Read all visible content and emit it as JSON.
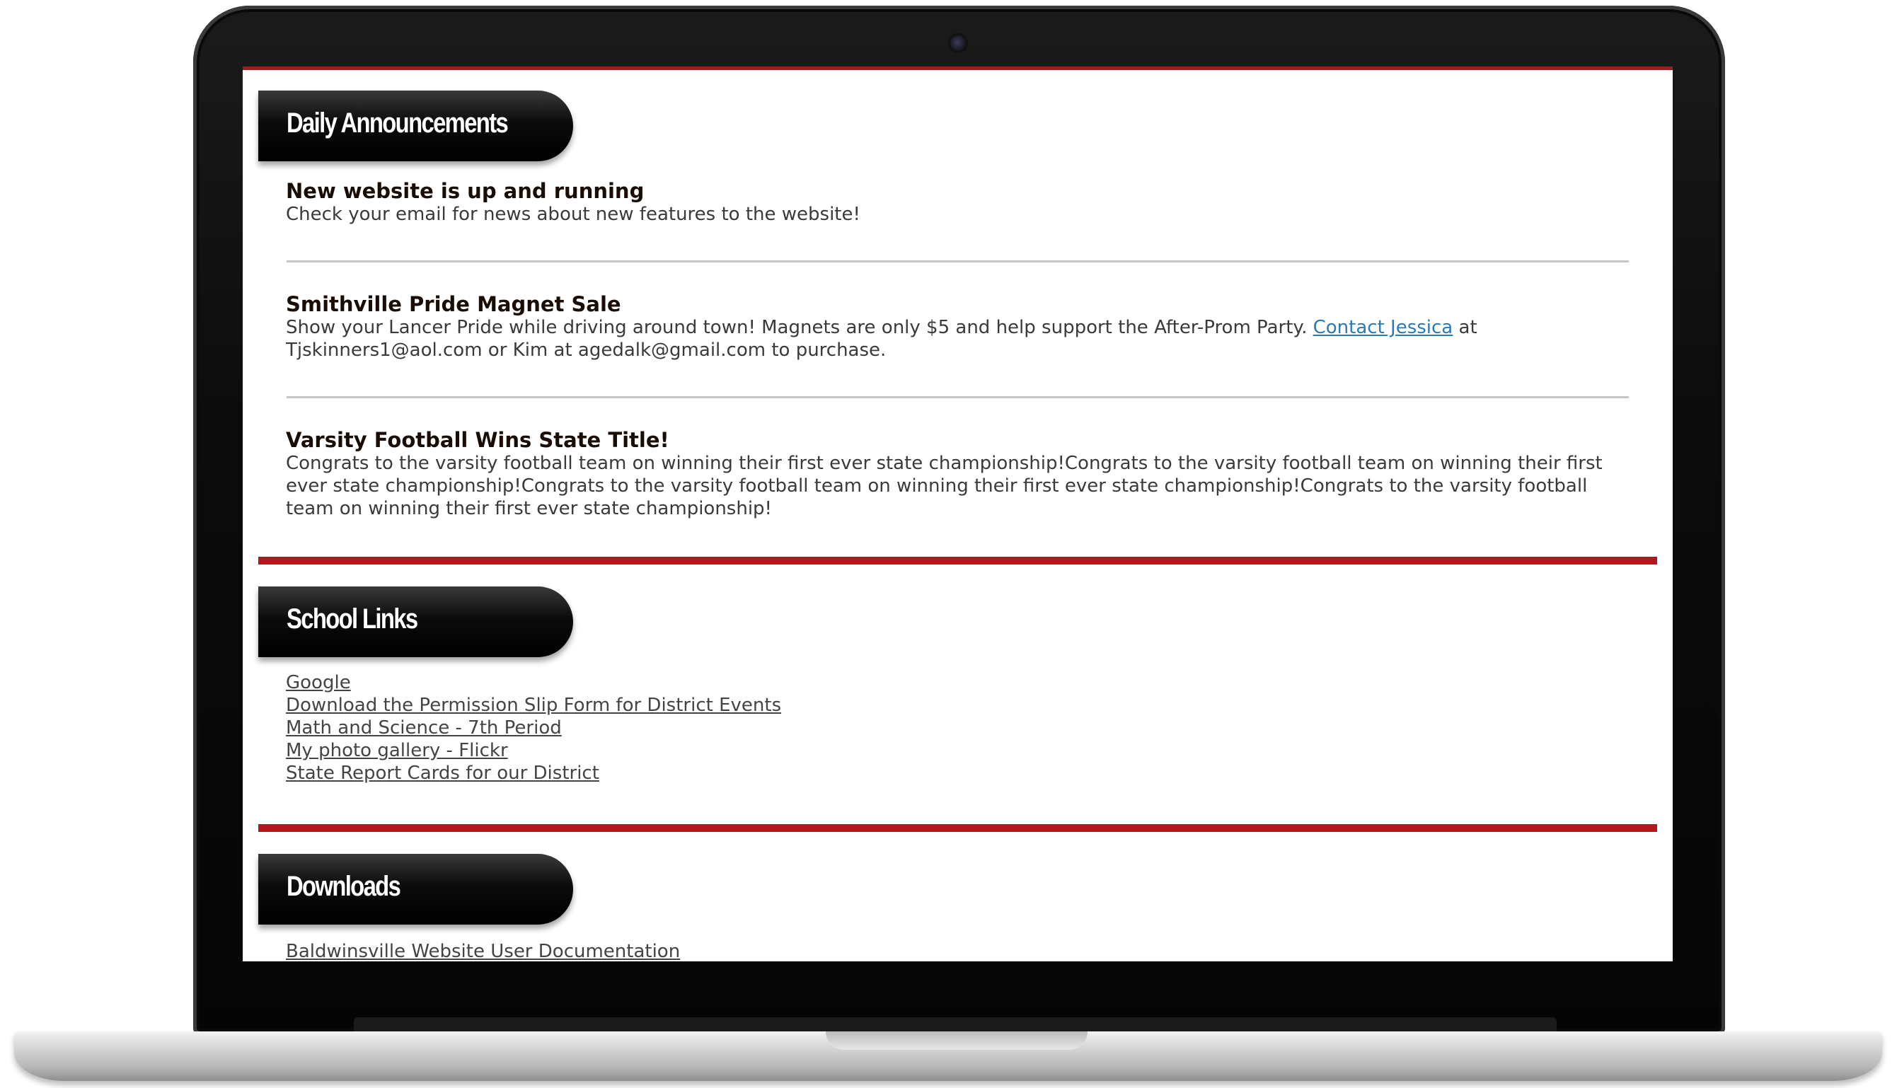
{
  "announcements": {
    "header": "Daily Announcements",
    "posts": [
      {
        "title": "New website is up and running",
        "body": "Check your email for news about new features to the website!"
      },
      {
        "title": "Smithville Pride Magnet Sale",
        "body_before": "Show your Lancer Pride while driving around town! Magnets are only $5 and help support the After-Prom Party. ",
        "link": "Contact Jessica",
        "body_after": " at Tjskinners1@aol.com or Kim at agedalk@gmail.com to purchase."
      },
      {
        "title": "Varsity Football Wins State Title!",
        "body": "Congrats to the varsity football team on winning their first ever state championship!Congrats to the varsity football team on winning their first ever state championship!Congrats to the varsity football team on winning their first ever state championship!Congrats to the varsity football team on winning their first ever state championship!"
      }
    ]
  },
  "school_links": {
    "header": "School Links",
    "items": [
      "Google",
      "Download the Permission Slip Form for District Events",
      "Math and Science - 7th Period",
      "My photo gallery - Flickr",
      "State Report Cards for our District"
    ]
  },
  "downloads": {
    "header": "Downloads",
    "items": [
      "Baldwinsville Website User Documentation"
    ]
  },
  "colors": {
    "accent_red": "#b3161c",
    "link_blue": "#2a7ab8",
    "tab_black": "#0b0b0b"
  }
}
